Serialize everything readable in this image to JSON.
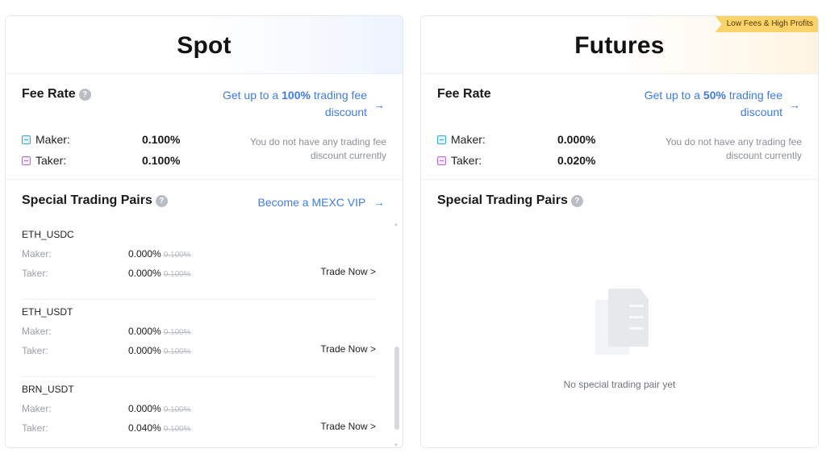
{
  "spot": {
    "title": "Spot",
    "fee_rate_label": "Fee Rate",
    "help_glyph": "?",
    "promo_prefix": "Get up to a ",
    "promo_highlight": "100%",
    "promo_suffix": " trading fee discount",
    "arrow": "→",
    "maker_label": "Maker:",
    "maker_value": "0.100%",
    "taker_label": "Taker:",
    "taker_value": "0.100%",
    "discount_note": "You do not have any trading fee discount currently",
    "special_pairs_label": "Special Trading Pairs",
    "vip_link": "Become a MEXC VIP",
    "pairs": [
      {
        "name": "ETH_USDC",
        "maker_label": "Maker:",
        "maker_value": "0.000%",
        "maker_old": "0.100%",
        "taker_label": "Taker:",
        "taker_value": "0.000%",
        "taker_old": "0.100%",
        "trade": "Trade Now >"
      },
      {
        "name": "ETH_USDT",
        "maker_label": "Maker:",
        "maker_value": "0.000%",
        "maker_old": "0.100%",
        "taker_label": "Taker:",
        "taker_value": "0.000%",
        "taker_old": "0.100%",
        "trade": "Trade Now >"
      },
      {
        "name": "BRN_USDT",
        "maker_label": "Maker:",
        "maker_value": "0.000%",
        "maker_old": "0.100%",
        "taker_label": "Taker:",
        "taker_value": "0.040%",
        "taker_old": "0.100%",
        "trade": "Trade Now >"
      }
    ]
  },
  "futures": {
    "title": "Futures",
    "ribbon": "Low Fees & High Profits",
    "fee_rate_label": "Fee Rate",
    "promo_prefix": "Get up to a ",
    "promo_highlight": "50%",
    "promo_suffix": " trading fee discount",
    "arrow": "→",
    "maker_label": "Maker:",
    "maker_value": "0.000%",
    "taker_label": "Taker:",
    "taker_value": "0.020%",
    "discount_note": "You do not have any trading fee discount currently",
    "special_pairs_label": "Special Trading Pairs",
    "help_glyph": "?",
    "empty_text": "No special trading pair yet"
  },
  "icons": {
    "help": "help-circle-icon",
    "arrow": "arrow-right-icon",
    "maker": "maker-badge-icon",
    "taker": "taker-badge-icon",
    "empty": "empty-document-icon"
  },
  "colors": {
    "accent_link": "#3f7bea",
    "maker_badge": "#35a7d9",
    "taker_badge": "#b668d8",
    "ribbon": "#f7d36a"
  }
}
